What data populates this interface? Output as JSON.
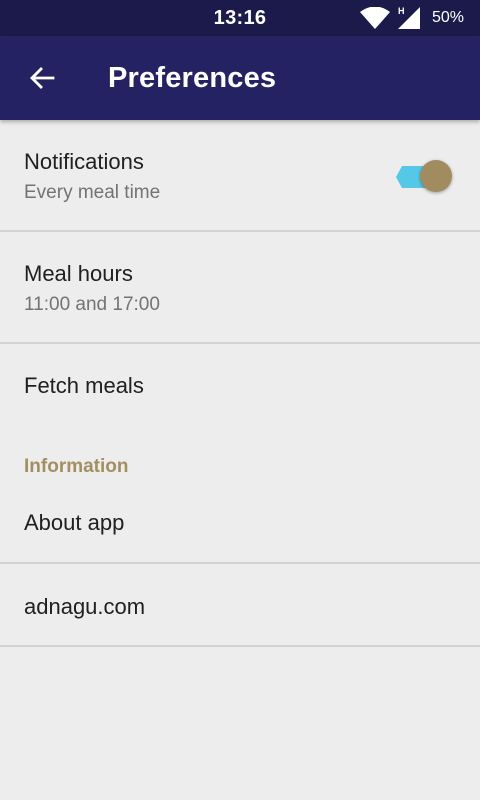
{
  "status_bar": {
    "time": "13:16",
    "network_type": "H",
    "battery": "50%"
  },
  "app_bar": {
    "title": "Preferences",
    "back_icon": "arrow-left-icon"
  },
  "preferences": {
    "notifications": {
      "title": "Notifications",
      "summary": "Every meal time",
      "enabled": true
    },
    "meal_hours": {
      "title": "Meal hours",
      "summary": "11:00 and 17:00"
    },
    "fetch_meals": {
      "title": "Fetch meals"
    }
  },
  "information_section": {
    "header": "Information",
    "about_app": {
      "title": "About app"
    },
    "website": {
      "title": "adnagu.com"
    }
  },
  "colors": {
    "status_bar": "#1c1a4a",
    "app_bar": "#252264",
    "accent": "#a48f61",
    "toggle_track": "#55c8e8",
    "background": "#ededed"
  }
}
